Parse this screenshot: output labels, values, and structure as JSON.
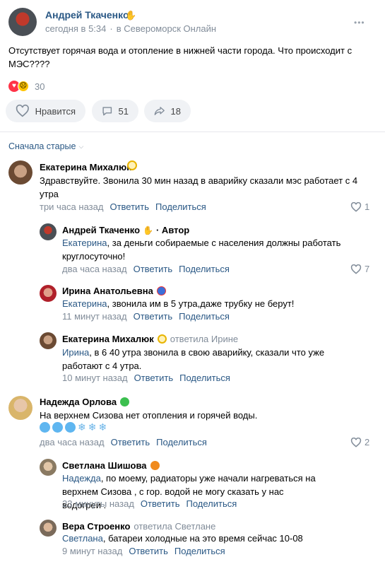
{
  "post": {
    "author": "Андрей Ткаченко",
    "time": "сегодня в 5:34",
    "separator": "·",
    "community": "в Североморск Онлайн",
    "text": "Отсутствует горячая вода и отопление в нижней части города. Что происходит с МЭС????",
    "reactions_count": "30",
    "like_label": "Нравится",
    "comments_count": "51",
    "shares_count": "18",
    "more_label": "•••"
  },
  "comments_sort": "Сначала старые",
  "comments": [
    {
      "name": "Екатерина Михалюк",
      "text": "Здравствуйте. Звонила 30 мин назад в аварийку сказали мэс работает с 4 утра",
      "time": "три часа назад",
      "reply": "Ответить",
      "share": "Поделиться",
      "likes": "1"
    },
    {
      "name": "Андрей Ткаченко",
      "badge": "· Автор",
      "addressee": "Екатерина",
      "text": ", за деньги собираемые с населения должны работать круглосуточно!",
      "time": "два часа назад",
      "reply": "Ответить",
      "share": "Поделиться",
      "likes": "7"
    },
    {
      "name": "Ирина Анатольевна",
      "addressee": "Екатерина",
      "text": ", звонила им в 5 утра,даже трубку не берут!",
      "time": "11 минут назад",
      "reply": "Ответить",
      "share": "Поделиться"
    },
    {
      "name": "Екатерина Михалюк",
      "replied_to": "ответила Ирине",
      "addressee": "Ирина",
      "text": ", в 6 40 утра звонила в свою аварийку, сказали что уже работают с 4 утра.",
      "time": "10 минут назад",
      "reply": "Ответить",
      "share": "Поделиться"
    },
    {
      "name": "Надежда Орлова",
      "text": "На верхнем Сизова нет отопления и горячей воды.",
      "time": "два часа назад",
      "reply": "Ответить",
      "share": "Поделиться",
      "likes": "2"
    },
    {
      "name": "Светлана Шишова",
      "addressee": "Надежда",
      "text": ", по моему, радиаторы уже начали нагреваться на верхнем Сизова , с гор. водой не могу сказать у нас водогреи .",
      "time": "23 минуты назад",
      "reply": "Ответить",
      "share": "Поделиться"
    },
    {
      "name": "Вера Строенко",
      "replied_to": "ответила Светлане",
      "addressee": "Светлана",
      "text": ", батареи холодные на это время сейчас 10-08",
      "time": "9 минут назад",
      "reply": "Ответить",
      "share": "Поделиться"
    }
  ],
  "colors": {
    "link": "#2a5885",
    "muted": "#818c99",
    "pill_bg": "#f0f2f5"
  }
}
